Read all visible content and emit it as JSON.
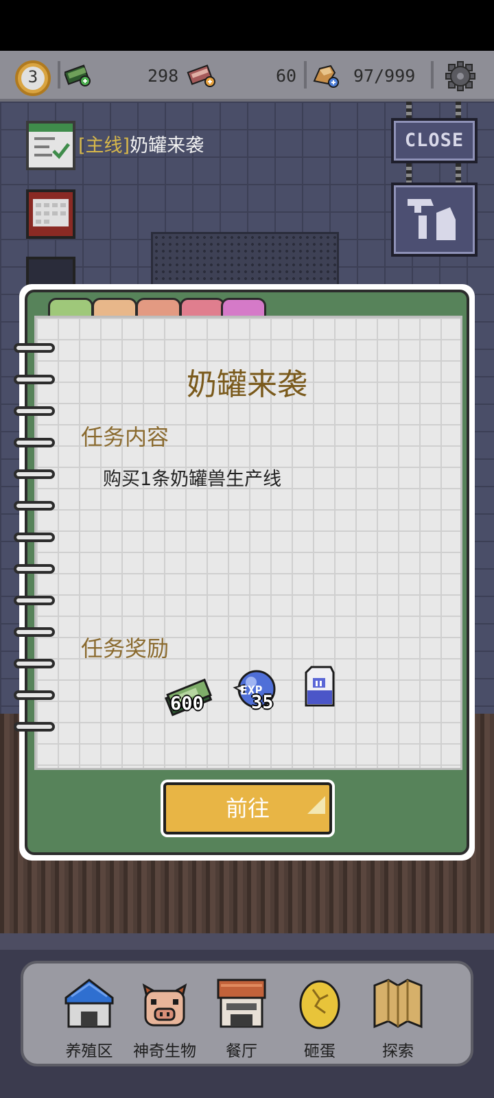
{
  "resources": {
    "level": "3",
    "cash": "298",
    "meat": "60",
    "capacity": "97/999"
  },
  "quest_hint": {
    "tag": "[主线]",
    "name": "奶罐来袭"
  },
  "close_sign": "CLOSE",
  "quest": {
    "title": "奶罐来袭",
    "content_heading": "任务内容",
    "content_text": "购买1条奶罐兽生产线",
    "reward_heading": "任务奖励",
    "rewards": [
      {
        "icon": "cash-stack-icon",
        "amount": "600"
      },
      {
        "icon": "exp-orb-icon",
        "amount": "35"
      },
      {
        "icon": "milk-carton-icon",
        "amount": ""
      }
    ],
    "go_button": "前往"
  },
  "tab_colors": [
    "#9fc87a",
    "#e8b78a",
    "#e39a82",
    "#e07e8e",
    "#d57ac8"
  ],
  "nav": [
    {
      "label": "养殖区",
      "icon": "barn-icon"
    },
    {
      "label": "神奇生物",
      "icon": "pig-creature-icon"
    },
    {
      "label": "餐厅",
      "icon": "restaurant-icon"
    },
    {
      "label": "砸蛋",
      "icon": "golden-egg-icon"
    },
    {
      "label": "探索",
      "icon": "map-icon"
    }
  ],
  "colors": {
    "accent_button": "#e8b545",
    "notebook_green": "#57835a",
    "quest_title": "#7a5a1c"
  }
}
